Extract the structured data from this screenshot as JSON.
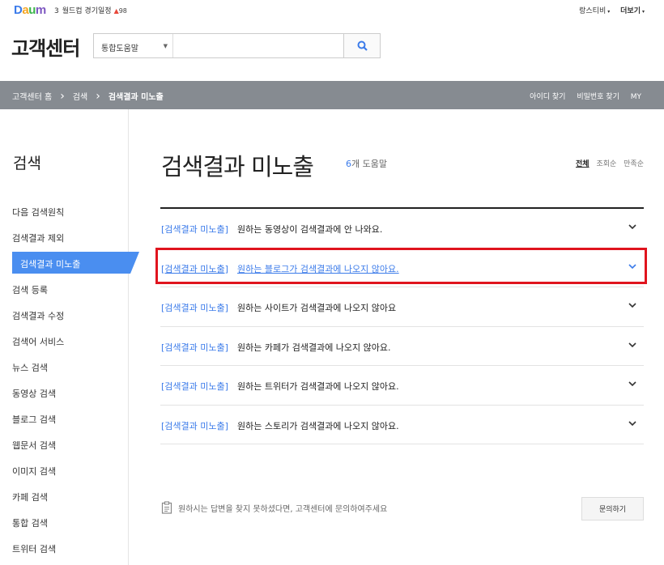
{
  "top": {
    "logo": [
      "D",
      "a",
      "u",
      "m"
    ],
    "rank_number": "3",
    "rank_text": "월드컵 경기일정",
    "rank_change": "98",
    "links": [
      "랑스티비",
      "더보기"
    ]
  },
  "header": {
    "title": "고객센터",
    "search_scope": "통합도움말",
    "search_value": ""
  },
  "breadcrumb": {
    "items": [
      "고객센터 홈",
      "검색",
      "검색결과 미노출"
    ],
    "links": [
      "아이디 찾기",
      "비밀번호 찾기",
      "MY"
    ]
  },
  "sidebar": {
    "title": "검색",
    "items": [
      {
        "label": "다음 검색원칙"
      },
      {
        "label": "검색결과 제외"
      },
      {
        "label": "검색결과 미노출"
      },
      {
        "label": "검색 등록"
      },
      {
        "label": "검색결과 수정"
      },
      {
        "label": "검색어 서비스"
      },
      {
        "label": "뉴스 검색"
      },
      {
        "label": "동영상 검색"
      },
      {
        "label": "블로그 검색"
      },
      {
        "label": "웹문서 검색"
      },
      {
        "label": "이미지 검색"
      },
      {
        "label": "카페 검색"
      },
      {
        "label": "통합 검색"
      },
      {
        "label": "트위터 검색"
      }
    ],
    "active_index": 2
  },
  "main": {
    "title": "검색결과 미노출",
    "count_num": "6",
    "count_suffix": "개 도움말",
    "sorts": [
      "전체",
      "조회순",
      "만족순"
    ],
    "faqs": [
      {
        "tag": "[검색결과 미노출]",
        "question": "원하는 동영상이 검색결과에 안 나와요."
      },
      {
        "tag": "[검색결과 미노출]",
        "question": "원하는 블로그가 검색결과에 나오지 않아요."
      },
      {
        "tag": "[검색결과 미노출]",
        "question": "원하는 사이트가 검색결과에 나오지 않아요"
      },
      {
        "tag": "[검색결과 미노출]",
        "question": "원하는 카페가 검색결과에 나오지 않아요."
      },
      {
        "tag": "[검색결과 미노출]",
        "question": "원하는 트위터가 검색결과에 나오지 않아요."
      },
      {
        "tag": "[검색결과 미노출]",
        "question": "원하는 스토리가 검색결과에 나오지 않아요."
      }
    ],
    "highlighted_index": 1
  },
  "footer": {
    "help_text": "원하시는 답변을 찾지 못하셨다면, 고객센터에 문의하여주세요",
    "ask_button": "문의하기"
  },
  "colors": {
    "accent": "#3b7bea",
    "crumb_bar": "#868b91",
    "active_side": "#4a8ef0",
    "highlight_box": "#e0141e"
  }
}
